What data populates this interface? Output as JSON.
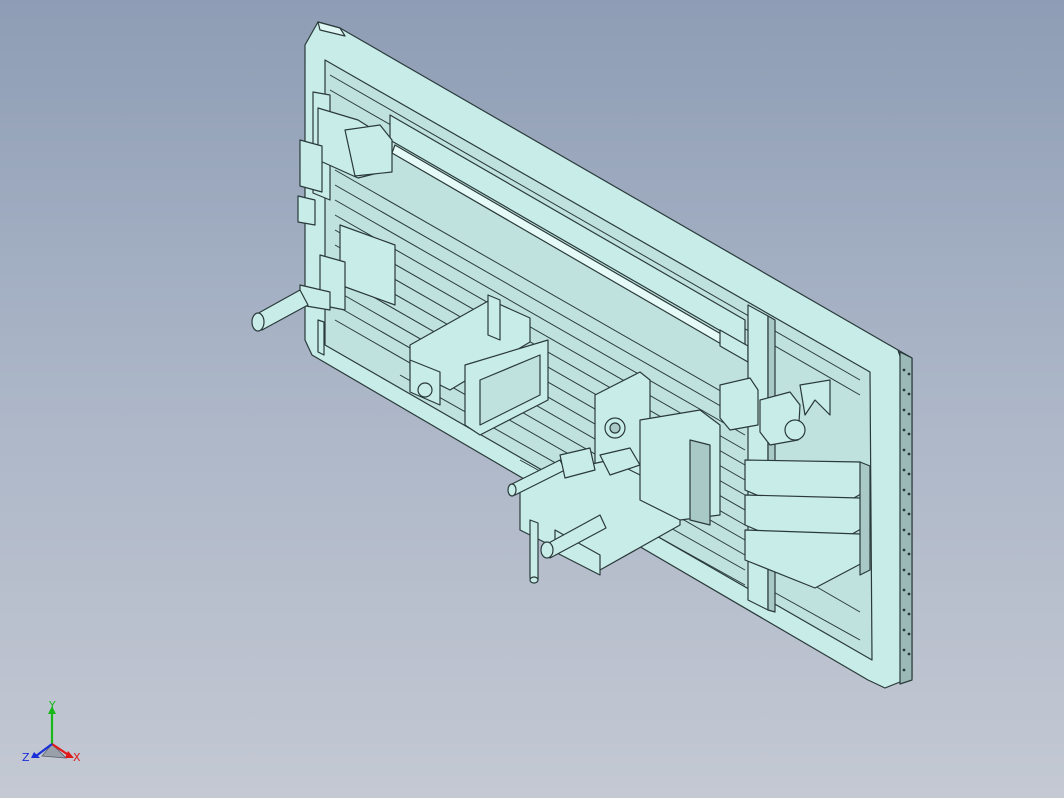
{
  "viewport": {
    "background_top": "#8e9db5",
    "background_bottom": "#c4c9d3",
    "part_color": "#c8ece8",
    "edge_color": "#2a3a3a"
  },
  "triad": {
    "x_label": "X",
    "y_label": "Y",
    "z_label": "Z",
    "x_color": "#e01818",
    "y_color": "#18b818",
    "z_color": "#1830d8"
  }
}
